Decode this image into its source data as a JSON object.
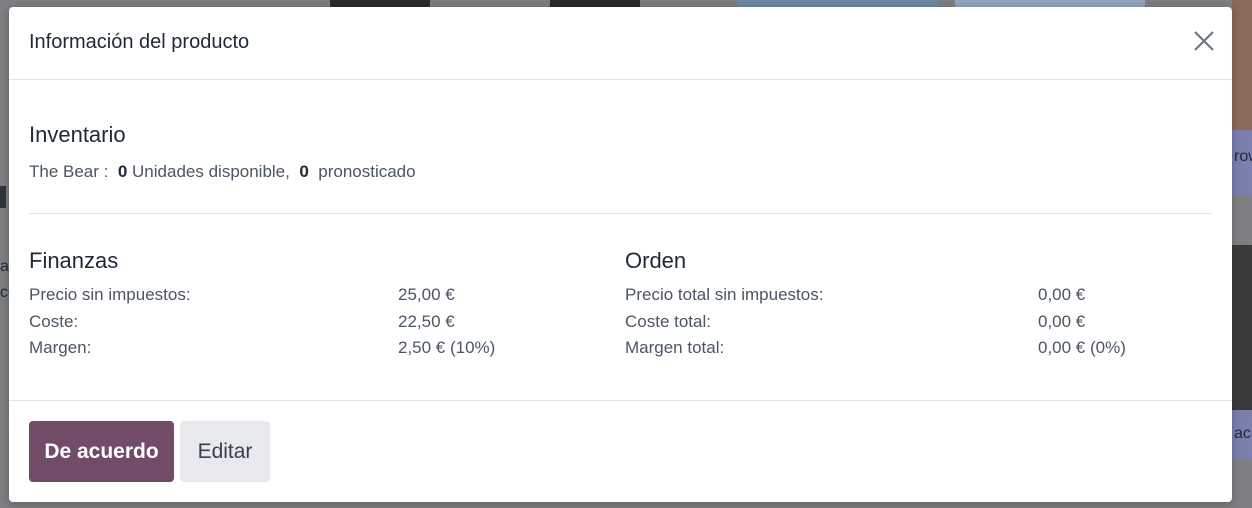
{
  "background": {
    "right_text_1": "row",
    "right_text_2": "ac",
    "left_text_1": "a",
    "left_text_2": "co"
  },
  "modal": {
    "title": "Información del producto",
    "close_icon": "close-icon",
    "inventory": {
      "title": "Inventario",
      "product": "The Bear :",
      "available_qty": "0",
      "available_label": "Unidades disponible,",
      "forecast_qty": "0",
      "forecast_label": "pronosticado"
    },
    "finances": {
      "title": "Finanzas",
      "rows": [
        {
          "label": "Precio sin impuestos:",
          "value": "25,00 €"
        },
        {
          "label": "Coste:",
          "value": "22,50 €"
        },
        {
          "label": "Margen:",
          "value": "2,50 € (10%)"
        }
      ]
    },
    "order": {
      "title": "Orden",
      "rows": [
        {
          "label": "Precio total sin impuestos:",
          "value": "0,00 €"
        },
        {
          "label": "Coste total:",
          "value": "0,00 €"
        },
        {
          "label": "Margen total:",
          "value": "0,00 € (0%)"
        }
      ]
    },
    "footer": {
      "ok_label": "De acuerdo",
      "edit_label": "Editar"
    }
  },
  "colors": {
    "primary": "#714b67",
    "secondary_bg": "#e7e9ed"
  }
}
